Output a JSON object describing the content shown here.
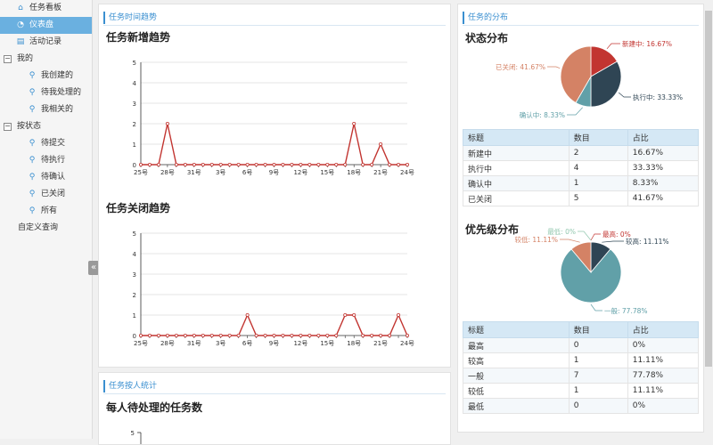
{
  "sidebar": {
    "items": [
      {
        "label": "任务看板",
        "icon": "home-icon",
        "glyph": "⌂",
        "level": 0,
        "active": false
      },
      {
        "label": "仪表盘",
        "icon": "dashboard-icon",
        "glyph": "◔",
        "level": 0,
        "active": true
      },
      {
        "label": "活动记录",
        "icon": "list-icon",
        "glyph": "▤",
        "level": 0,
        "active": false
      }
    ],
    "groups": [
      {
        "label": "我的",
        "toggle": "−",
        "items": [
          "我创建的",
          "待我处理的",
          "我相关的"
        ]
      },
      {
        "label": "按状态",
        "toggle": "−",
        "items": [
          "待提交",
          "待执行",
          "待确认",
          "已关闭",
          "所有"
        ]
      }
    ],
    "custom_query": "自定义查询",
    "collapse_glyph": "«"
  },
  "trend_panel": {
    "tab": "任务时间趋势",
    "new_title": "任务新增趋势",
    "close_title": "任务关闭趋势"
  },
  "person_panel": {
    "tab": "任务按人统计",
    "title": "每人待处理的任务数",
    "y_tick": "5"
  },
  "dist_panel": {
    "tab": "任务的分布",
    "status_title": "状态分布",
    "priority_title": "优先级分布",
    "table_headers": [
      "标题",
      "数目",
      "占比"
    ],
    "status_rows": [
      {
        "name": "新建中",
        "count": "2",
        "pct": "16.67%"
      },
      {
        "name": "执行中",
        "count": "4",
        "pct": "33.33%"
      },
      {
        "name": "确认中",
        "count": "1",
        "pct": "8.33%"
      },
      {
        "name": "已关闭",
        "count": "5",
        "pct": "41.67%"
      }
    ],
    "priority_rows": [
      {
        "name": "最高",
        "count": "0",
        "pct": "0%"
      },
      {
        "name": "较高",
        "count": "1",
        "pct": "11.11%"
      },
      {
        "name": "一般",
        "count": "7",
        "pct": "77.78%"
      },
      {
        "name": "较低",
        "count": "1",
        "pct": "11.11%"
      },
      {
        "name": "最低",
        "count": "0",
        "pct": "0%"
      }
    ]
  },
  "chart_data": [
    {
      "type": "line",
      "title": "任务新增趋势",
      "categories": [
        "25号",
        "26号",
        "27号",
        "28号",
        "29号",
        "30号",
        "31号",
        "1号",
        "2号",
        "3号",
        "4号",
        "5号",
        "6号",
        "7号",
        "8号",
        "9号",
        "10号",
        "11号",
        "12号",
        "13号",
        "14号",
        "15号",
        "16号",
        "17号",
        "18号",
        "19号",
        "20号",
        "21号",
        "22号",
        "23号",
        "24号"
      ],
      "tick_labels": [
        "25号",
        "28号",
        "31号",
        "3号",
        "6号",
        "9号",
        "12号",
        "15号",
        "18号",
        "21号",
        "24号"
      ],
      "values": [
        0,
        0,
        0,
        2,
        0,
        0,
        0,
        0,
        0,
        0,
        0,
        0,
        0,
        0,
        0,
        0,
        0,
        0,
        0,
        0,
        0,
        0,
        0,
        0,
        2,
        0,
        0,
        1,
        0,
        0,
        0
      ],
      "ylim": [
        0,
        5
      ],
      "yticks": [
        "0",
        "1",
        "2",
        "3",
        "4",
        "5"
      ],
      "color": "#c23531"
    },
    {
      "type": "line",
      "title": "任务关闭趋势",
      "categories": [
        "25号",
        "26号",
        "27号",
        "28号",
        "29号",
        "30号",
        "31号",
        "1号",
        "2号",
        "3号",
        "4号",
        "5号",
        "6号",
        "7号",
        "8号",
        "9号",
        "10号",
        "11号",
        "12号",
        "13号",
        "14号",
        "15号",
        "16号",
        "17号",
        "18号",
        "19号",
        "20号",
        "21号",
        "22号",
        "23号",
        "24号"
      ],
      "tick_labels": [
        "25号",
        "28号",
        "31号",
        "3号",
        "6号",
        "9号",
        "12号",
        "15号",
        "18号",
        "21号",
        "24号"
      ],
      "values": [
        0,
        0,
        0,
        0,
        0,
        0,
        0,
        0,
        0,
        0,
        0,
        0,
        1,
        0,
        0,
        0,
        0,
        0,
        0,
        0,
        0,
        0,
        0,
        1,
        1,
        0,
        0,
        0,
        0,
        1,
        0
      ],
      "ylim": [
        0,
        5
      ],
      "yticks": [
        "0",
        "1",
        "2",
        "3",
        "4",
        "5"
      ],
      "color": "#c23531"
    },
    {
      "type": "pie",
      "title": "状态分布",
      "slices": [
        {
          "name": "新建中",
          "value": 2,
          "label": "新建中: 16.67%",
          "color": "#c23531"
        },
        {
          "name": "执行中",
          "value": 4,
          "label": "执行中: 33.33%",
          "color": "#2f4554"
        },
        {
          "name": "确认中",
          "value": 1,
          "label": "确认中: 8.33%",
          "color": "#61a0a8"
        },
        {
          "name": "已关闭",
          "value": 5,
          "label": "已关闭: 41.67%",
          "color": "#d48265"
        }
      ]
    },
    {
      "type": "pie",
      "title": "优先级分布",
      "slices": [
        {
          "name": "最高",
          "value": 0,
          "label": "最高: 0%",
          "color": "#c23531"
        },
        {
          "name": "较高",
          "value": 1,
          "label": "较高: 11.11%",
          "color": "#2f4554"
        },
        {
          "name": "一般",
          "value": 7,
          "label": "一般: 77.78%",
          "color": "#61a0a8"
        },
        {
          "name": "较低",
          "value": 1,
          "label": "较低: 11.11%",
          "color": "#d48265"
        },
        {
          "name": "最低",
          "value": 0,
          "label": "最低: 0%",
          "color": "#91c7ae"
        }
      ]
    }
  ]
}
